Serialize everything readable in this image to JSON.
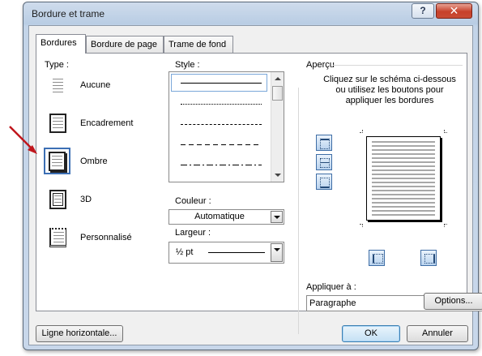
{
  "window": {
    "title": "Bordure et trame",
    "help_label": "?",
    "close_label": "✕"
  },
  "tabs": [
    {
      "label": "Bordures",
      "active": true
    },
    {
      "label": "Bordure de page",
      "active": false
    },
    {
      "label": "Trame de fond",
      "active": false
    }
  ],
  "type": {
    "label": "Type :",
    "items": [
      {
        "label": "Aucune",
        "icon": "border-none-icon",
        "selected": false
      },
      {
        "label": "Encadrement",
        "icon": "border-box-icon",
        "selected": false
      },
      {
        "label": "Ombre",
        "icon": "border-shadow-icon",
        "selected": true
      },
      {
        "label": "3D",
        "icon": "border-3d-icon",
        "selected": false
      },
      {
        "label": "Personnalisé",
        "icon": "border-custom-icon",
        "selected": false
      }
    ]
  },
  "style": {
    "label": "Style :",
    "items": [
      "solid",
      "dotted",
      "dashed-small",
      "dashed",
      "dash-dot"
    ],
    "selected_index": 0
  },
  "color": {
    "label": "Couleur :",
    "value": "Automatique"
  },
  "width": {
    "label": "Largeur :",
    "value": "½ pt"
  },
  "preview": {
    "label": "Aperçu",
    "instructions": [
      "Cliquez sur le schéma ci-dessous",
      "ou utilisez les boutons pour",
      "appliquer les bordures"
    ]
  },
  "apply": {
    "label": "Appliquer à :",
    "value": "Paragraphe"
  },
  "buttons": {
    "options": "Options...",
    "horizontal_line": "Ligne horizontale...",
    "ok": "OK",
    "cancel": "Annuler"
  },
  "colors": {
    "selection": "#3c6fb4",
    "annotation_arrow": "#c0161c"
  }
}
